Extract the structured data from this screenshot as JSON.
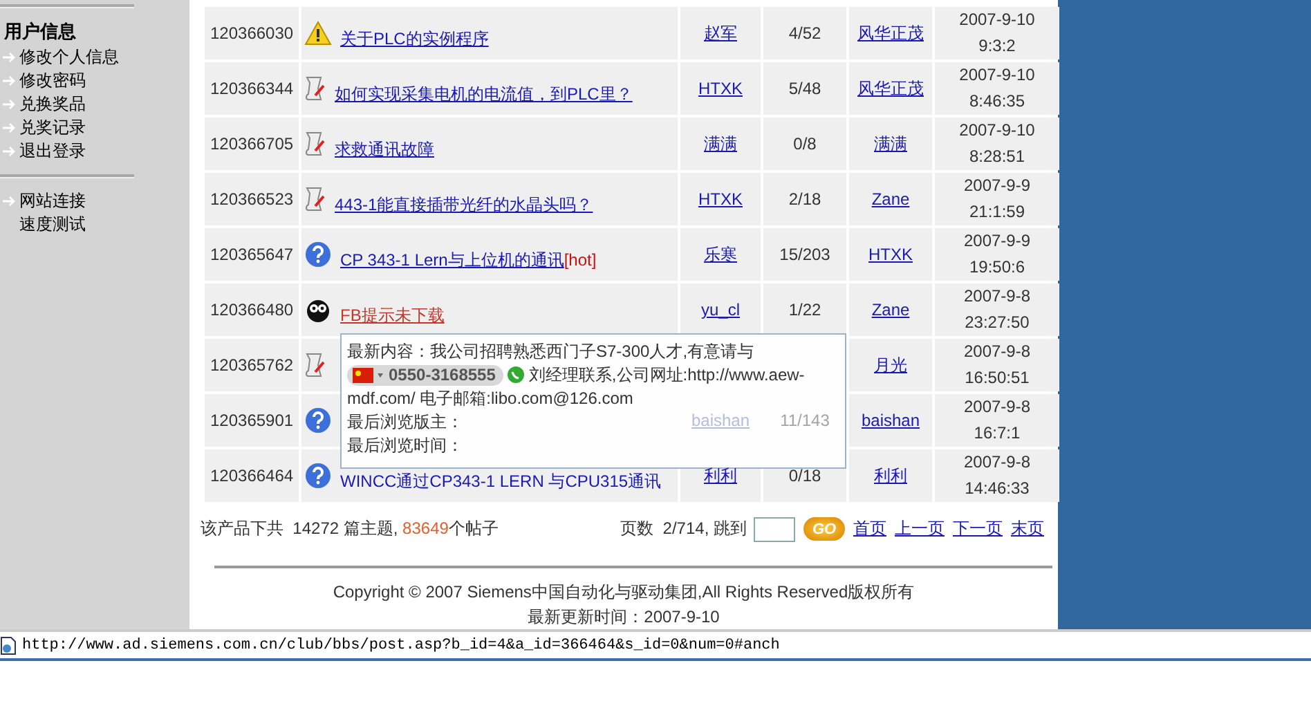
{
  "sidebar": {
    "heading": "用户信息",
    "groups": [
      {
        "items": [
          {
            "label": "修改个人信息",
            "arrow": true
          },
          {
            "label": "修改密码",
            "arrow": true
          },
          {
            "label": "兑换奖品",
            "arrow": true
          },
          {
            "label": "兑奖记录",
            "arrow": true
          },
          {
            "label": "退出登录",
            "arrow": true
          }
        ]
      },
      {
        "items": [
          {
            "label": "网站连接",
            "arrow": true
          },
          {
            "label": "速度测试",
            "arrow": false
          }
        ]
      }
    ]
  },
  "table": {
    "rows": [
      {
        "id": "120366030",
        "kind": "warning",
        "title": "关于PLC的实例程序",
        "visited": false,
        "tag": "",
        "author": "赵军",
        "replies": "4/52",
        "last_poster": "风华正茂",
        "date": "2007-9-10",
        "time": "9:3:2"
      },
      {
        "id": "120366344",
        "kind": "note",
        "title": "如何实现采集电机的电流值，到PLC里？",
        "visited": false,
        "tag": "",
        "author": "HTXK",
        "replies": "5/48",
        "last_poster": "风华正茂",
        "date": "2007-9-10",
        "time": "8:46:35"
      },
      {
        "id": "120366705",
        "kind": "note",
        "title": "求救通讯故障",
        "visited": false,
        "tag": "",
        "author": "满满",
        "replies": "0/8",
        "last_poster": "满满",
        "date": "2007-9-10",
        "time": "8:28:51"
      },
      {
        "id": "120366523",
        "kind": "note",
        "title": "443-1能直接插带光纤的水晶头吗？",
        "visited": false,
        "tag": "",
        "author": "HTXK",
        "replies": "2/18",
        "last_poster": "Zane",
        "date": "2007-9-9",
        "time": "21:1:59"
      },
      {
        "id": "120365647",
        "kind": "question",
        "title": "CP 343-1 Lern与上位机的通讯",
        "visited": false,
        "tag": "[hot]",
        "author": "乐寒",
        "replies": "15/203",
        "last_poster": "HTXK",
        "date": "2007-9-9",
        "time": "19:50:6"
      },
      {
        "id": "120366480",
        "kind": "owl",
        "title": "FB提示未下载",
        "visited": true,
        "tag": "",
        "author": "yu_cl",
        "replies": "1/22",
        "last_poster": "Zane",
        "date": "2007-9-8",
        "time": "23:27:50"
      },
      {
        "id": "120365762",
        "kind": "note",
        "last_poster": "月光",
        "date": "2007-9-8",
        "time": "16:50:51"
      },
      {
        "id": "120365901",
        "kind": "question",
        "author": "baishan",
        "replies": "11/143",
        "covered": true,
        "last_poster": "baishan",
        "date": "2007-9-8",
        "time": "16:7:1"
      },
      {
        "id": "120366464",
        "kind": "question",
        "title": "WINCC通过CP343-1 LERN 与CPU315通讯",
        "visited": false,
        "hovered": true,
        "tag": "",
        "author": "利利",
        "replies": "0/18",
        "last_poster": "利利",
        "date": "2007-9-8",
        "time": "14:46:33"
      }
    ]
  },
  "tooltip": {
    "line_1": "最新内容：我公司招聘熟悉西门子S7-300人才,有意请与",
    "phone": "0550-3168555",
    "line_2": "刘经理联系,公司网址:http://www.aew-",
    "line_3": "mdf.com/ 电子邮箱:libo.com@126.com",
    "line_4": "最后浏览版主：",
    "line_5": "最后浏览时间："
  },
  "summary": {
    "prefix": "该产品下共  14272 篇主题, ",
    "posts": "83649",
    "suffix": "个帖子"
  },
  "pager": {
    "label": "页数  2/714, 跳到",
    "go": "GO",
    "links": [
      "首页",
      "上一页",
      "下一页",
      "末页"
    ]
  },
  "footer": {
    "copyright": "Copyright © 2007 Siemens中国自动化与驱动集团,All Rights Reserved版权所有",
    "updated": "最新更新时间：2007-9-10"
  },
  "status_bar": {
    "url": "http://www.ad.siemens.com.cn/club/bbs/post.asp?b_id=4&a_id=366464&s_id=0&num=0#anch"
  }
}
